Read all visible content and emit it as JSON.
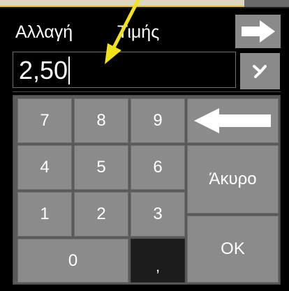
{
  "dialog": {
    "title_word1": "Αλλαγή",
    "title_word2": "Τιμής",
    "forward_icon": "arrow-right-icon",
    "value": "2,50",
    "clear_icon": "close-x-icon"
  },
  "keypad": {
    "keys": {
      "k7": "7",
      "k8": "8",
      "k9": "9",
      "k4": "4",
      "k5": "5",
      "k6": "6",
      "k1": "1",
      "k2": "2",
      "k3": "3",
      "k0": "0",
      "comma": ",",
      "cancel": "Άκυρο",
      "ok": "OK"
    },
    "backspace_icon": "arrow-left-icon"
  },
  "colors": {
    "key_bg": "#8b8b8b",
    "key_dark_bg": "#1c1c1c",
    "pointer_arrow": "#f2e21a"
  }
}
